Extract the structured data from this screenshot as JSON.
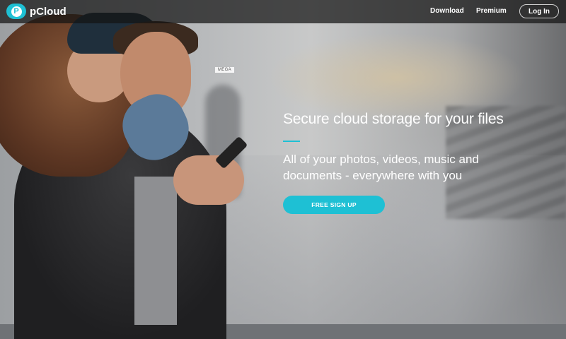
{
  "brand": {
    "name": "pCloud",
    "icon": "pcloud-logo-icon",
    "icon_letter": "P",
    "accent_color": "#1ec0d4"
  },
  "nav": {
    "links": [
      {
        "label": "Download"
      },
      {
        "label": "Premium"
      }
    ],
    "login_label": "Log In"
  },
  "hero": {
    "photo_tag": "MEGA",
    "headline": "Secure cloud storage for your files",
    "subhead": "All of your photos, videos, music and documents - everywhere with you",
    "cta_label": "FREE SIGN UP"
  }
}
